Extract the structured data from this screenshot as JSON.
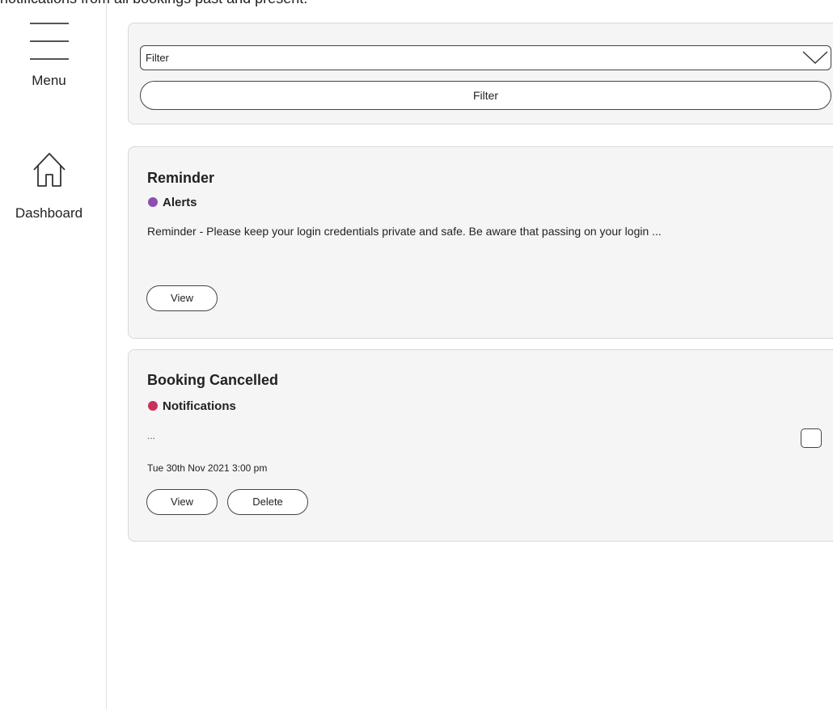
{
  "header": {
    "intro_text": "notifications from all bookings past and present."
  },
  "sidebar": {
    "items": [
      {
        "label": "Menu",
        "icon": "hamburger-menu-icon"
      },
      {
        "label": "Dashboard",
        "icon": "home-icon"
      }
    ]
  },
  "filter": {
    "select_value": "Filter",
    "button_label": "Filter"
  },
  "notifications": [
    {
      "title": "Reminder",
      "category": "Alerts",
      "category_color": "#8b4fb3",
      "body": "Reminder - Please keep your login credentials private and safe. Be aware that passing on your login ...",
      "date": "",
      "view_label": "View"
    },
    {
      "title": "Booking Cancelled",
      "category": "Notifications",
      "category_color": "#c8305a",
      "body": "...",
      "date": "Tue 30th Nov 2021 3:00 pm",
      "view_label": "View",
      "delete_label": "Delete"
    }
  ]
}
